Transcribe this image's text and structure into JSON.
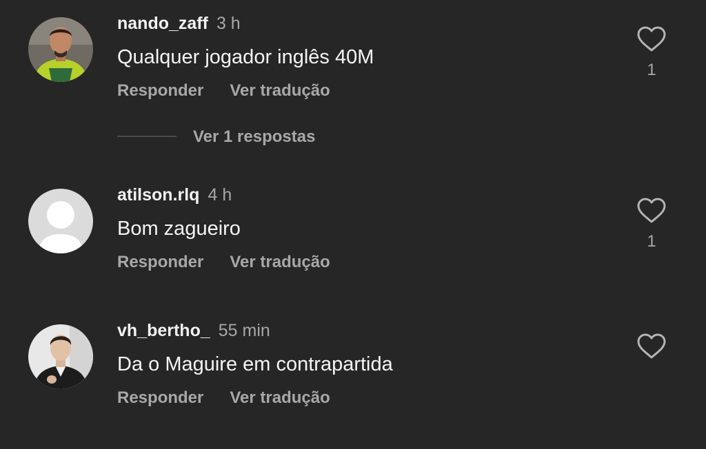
{
  "comments": [
    {
      "username": "nando_zaff",
      "time": "3 h",
      "text": "Qualquer jogador inglês 40M",
      "reply_label": "Responder",
      "translate_label": "Ver tradução",
      "likes": "1",
      "avatar": "user-photo-green-shirt"
    },
    {
      "username": "atilson.rlq",
      "time": "4 h",
      "text": "Bom zagueiro",
      "reply_label": "Responder",
      "translate_label": "Ver tradução",
      "likes": "1",
      "avatar": "default-avatar"
    },
    {
      "username": "vh_bertho_",
      "time": "55 min",
      "text": "Da o Maguire em contrapartida",
      "reply_label": "Responder",
      "translate_label": "Ver tradução",
      "likes": "",
      "avatar": "user-photo-dark-jacket"
    }
  ],
  "replies_toggle": {
    "label": "Ver 1 respostas"
  },
  "colors": {
    "background": "#262626",
    "primary_text": "#f5f5f5",
    "secondary_text": "#a8a8a8",
    "divider": "#4a4a4a"
  },
  "icons": {
    "like": "heart-outline-icon"
  }
}
